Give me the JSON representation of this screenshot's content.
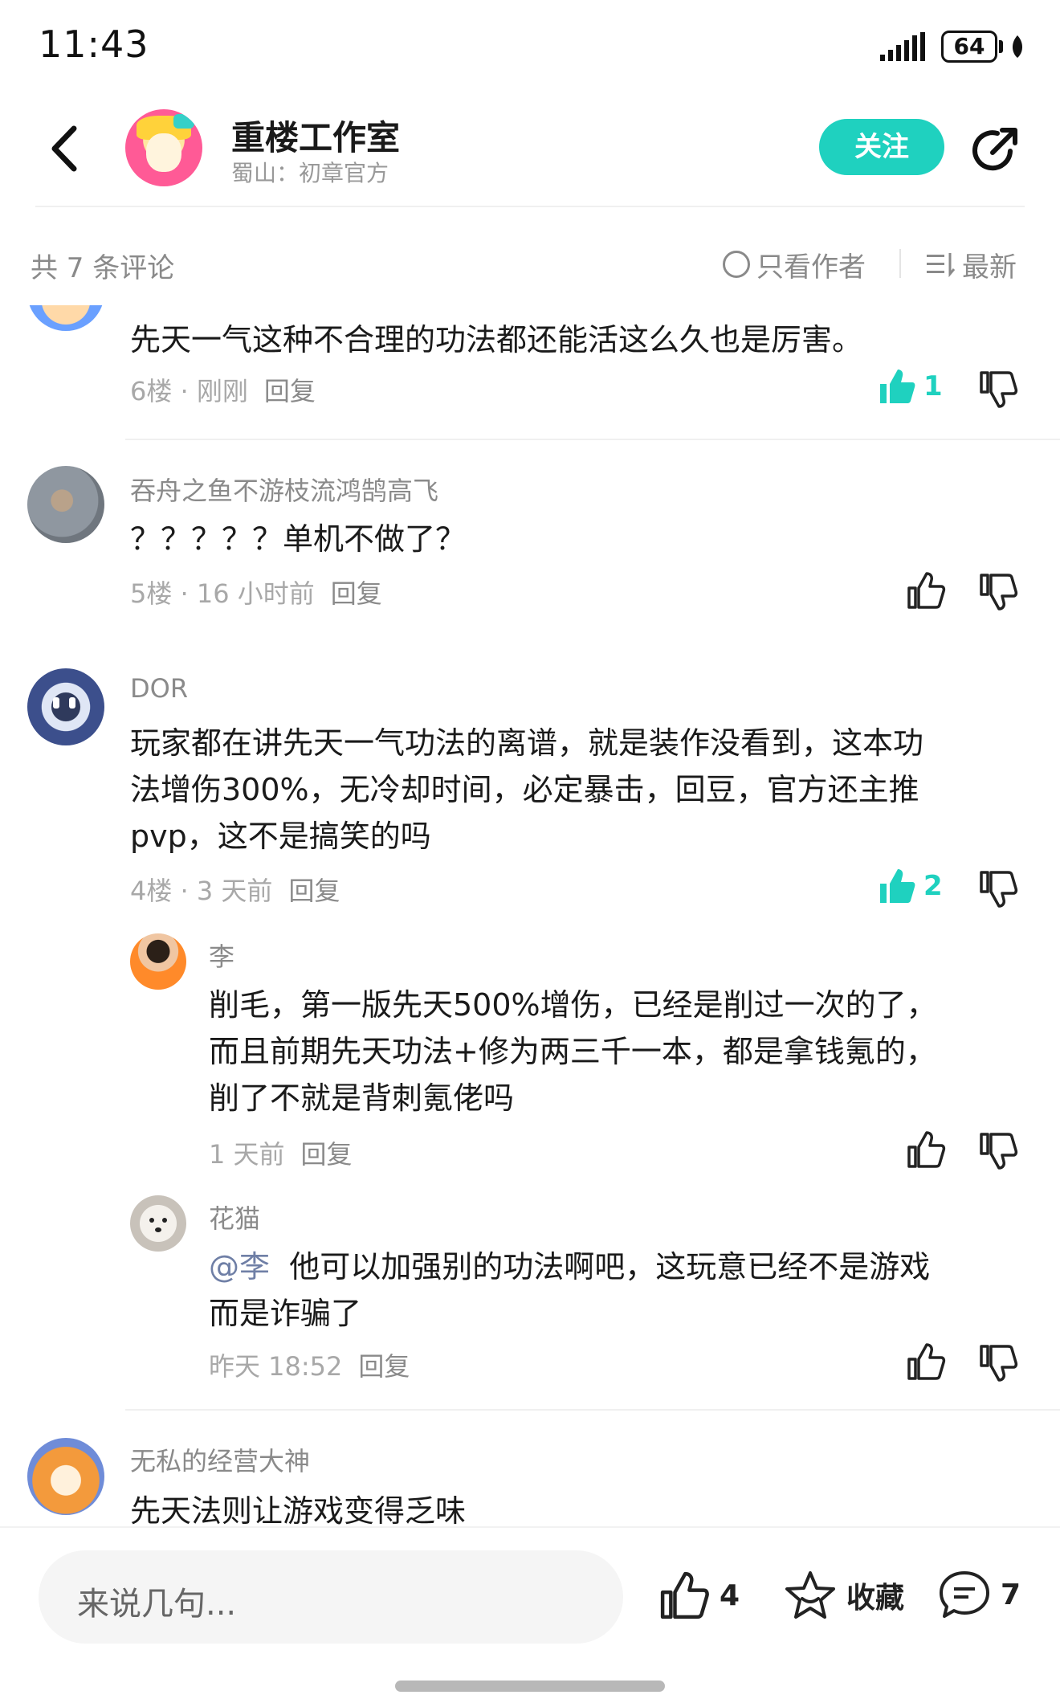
{
  "status_bar": {
    "time": "11:43",
    "battery": "64"
  },
  "header": {
    "title": "重楼工作室",
    "subtitle": "蜀山：初章官方",
    "follow_label": "关注"
  },
  "filter": {
    "count_text": "共 7 条评论",
    "author_only_label": "只看作者",
    "sort_label": "最新"
  },
  "comments": [
    {
      "author": "",
      "text": "先天一气这种不合理的功法都还能活这么久也是厉害。",
      "floor": "6楼",
      "time": "刚刚",
      "reply": "回复",
      "likes": "1",
      "liked": true
    },
    {
      "author": "吞舟之鱼不游枝流鸿鹄高飞",
      "text": "？？？？？单机不做了？",
      "floor": "5楼",
      "time": "16 小时前",
      "reply": "回复",
      "likes": "",
      "liked": false
    },
    {
      "author": "DOR",
      "text_lines": [
        "玩家都在讲先天一气功法的离谱，就是装作没看到，这本功",
        "法增伤300%，无冷却时间，必定暴击，回豆，官方还主推",
        "pvp，这不是搞笑的吗"
      ],
      "floor": "4楼",
      "time": "3 天前",
      "reply": "回复",
      "likes": "2",
      "liked": true,
      "replies": [
        {
          "author": "李",
          "text_lines": [
            "削毛，第一版先天500%增伤，已经是削过一次的了，",
            "而且前期先天功法+修为两三千一本，都是拿钱氪的，",
            "削了不就是背刺氪佬吗"
          ],
          "time": "1 天前",
          "reply": "回复"
        },
        {
          "author": "花猫",
          "mention": "@李",
          "text_lines": [
            "他可以加强别的功法啊吧，这玩意已经不是游戏",
            "而是诈骗了"
          ],
          "time": "昨天 18:52",
          "reply": "回复"
        }
      ]
    },
    {
      "author": "无私的经营大神",
      "text": "先天法则让游戏变得乏味"
    }
  ],
  "bottom_bar": {
    "input_placeholder": "来说几句...",
    "like_count": "4",
    "favorite_label": "收藏",
    "comment_count": "7"
  },
  "colors": {
    "accent": "#1fd1bf",
    "text_primary": "#1a1a1a",
    "text_secondary": "#8a8a8a"
  }
}
